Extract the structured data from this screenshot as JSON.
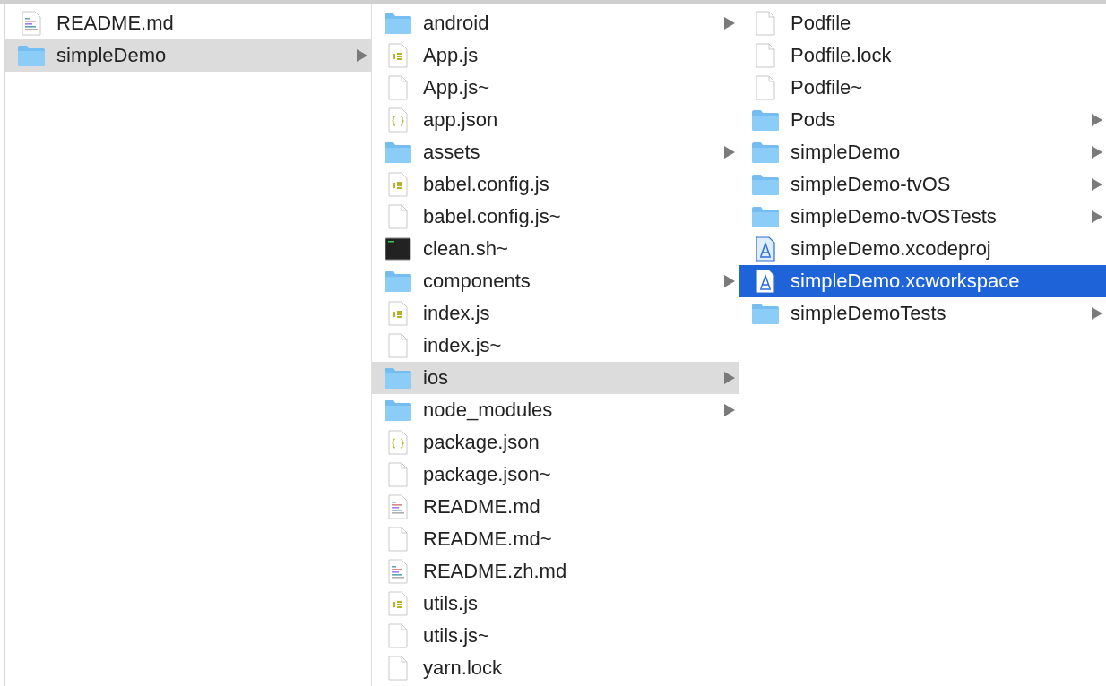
{
  "columns": [
    {
      "focused": false,
      "items": [
        {
          "name": "README.md",
          "kind": "markdown",
          "expandable": false,
          "selected": false
        },
        {
          "name": "simpleDemo",
          "kind": "folder",
          "expandable": true,
          "selected": true
        }
      ]
    },
    {
      "focused": false,
      "items": [
        {
          "name": "android",
          "kind": "folder",
          "expandable": true,
          "selected": false
        },
        {
          "name": "App.js",
          "kind": "js",
          "expandable": false,
          "selected": false
        },
        {
          "name": "App.js~",
          "kind": "blank",
          "expandable": false,
          "selected": false
        },
        {
          "name": "app.json",
          "kind": "json",
          "expandable": false,
          "selected": false
        },
        {
          "name": "assets",
          "kind": "folder",
          "expandable": true,
          "selected": false
        },
        {
          "name": "babel.config.js",
          "kind": "js",
          "expandable": false,
          "selected": false
        },
        {
          "name": "babel.config.js~",
          "kind": "blank",
          "expandable": false,
          "selected": false
        },
        {
          "name": "clean.sh~",
          "kind": "shell",
          "expandable": false,
          "selected": false
        },
        {
          "name": "components",
          "kind": "folder",
          "expandable": true,
          "selected": false
        },
        {
          "name": "index.js",
          "kind": "js",
          "expandable": false,
          "selected": false
        },
        {
          "name": "index.js~",
          "kind": "blank",
          "expandable": false,
          "selected": false
        },
        {
          "name": "ios",
          "kind": "folder",
          "expandable": true,
          "selected": true
        },
        {
          "name": "node_modules",
          "kind": "folder",
          "expandable": true,
          "selected": false
        },
        {
          "name": "package.json",
          "kind": "json",
          "expandable": false,
          "selected": false
        },
        {
          "name": "package.json~",
          "kind": "blank",
          "expandable": false,
          "selected": false
        },
        {
          "name": "README.md",
          "kind": "markdown",
          "expandable": false,
          "selected": false
        },
        {
          "name": "README.md~",
          "kind": "blank",
          "expandable": false,
          "selected": false
        },
        {
          "name": "README.zh.md",
          "kind": "markdown",
          "expandable": false,
          "selected": false
        },
        {
          "name": "utils.js",
          "kind": "js",
          "expandable": false,
          "selected": false
        },
        {
          "name": "utils.js~",
          "kind": "blank",
          "expandable": false,
          "selected": false
        },
        {
          "name": "yarn.lock",
          "kind": "blank",
          "expandable": false,
          "selected": false
        }
      ]
    },
    {
      "focused": true,
      "items": [
        {
          "name": "Podfile",
          "kind": "blank",
          "expandable": false,
          "selected": false
        },
        {
          "name": "Podfile.lock",
          "kind": "blank",
          "expandable": false,
          "selected": false
        },
        {
          "name": "Podfile~",
          "kind": "blank",
          "expandable": false,
          "selected": false
        },
        {
          "name": "Pods",
          "kind": "folder",
          "expandable": true,
          "selected": false
        },
        {
          "name": "simpleDemo",
          "kind": "folder",
          "expandable": true,
          "selected": false
        },
        {
          "name": "simpleDemo-tvOS",
          "kind": "folder",
          "expandable": true,
          "selected": false
        },
        {
          "name": "simpleDemo-tvOSTests",
          "kind": "folder",
          "expandable": true,
          "selected": false
        },
        {
          "name": "simpleDemo.xcodeproj",
          "kind": "xcode",
          "expandable": false,
          "selected": false
        },
        {
          "name": "simpleDemo.xcworkspace",
          "kind": "xcode",
          "expandable": false,
          "selected": true
        },
        {
          "name": "simpleDemoTests",
          "kind": "folder",
          "expandable": true,
          "selected": false
        }
      ]
    }
  ]
}
